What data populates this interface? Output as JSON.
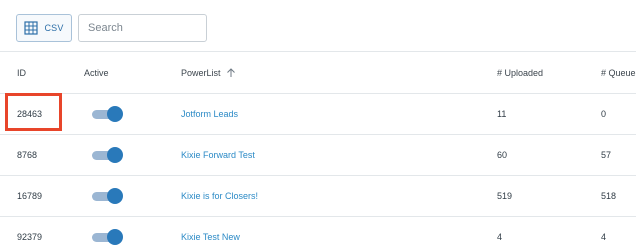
{
  "toolbar": {
    "csv_label": "CSV",
    "csv_icon": "grid-icon",
    "search_placeholder": "Search",
    "search_value": ""
  },
  "table": {
    "columns": {
      "id": "ID",
      "active": "Active",
      "powerlist": "PowerList",
      "uploaded": "# Uploaded",
      "queued": "# Queue"
    },
    "sort": {
      "column": "powerlist",
      "direction": "ascending",
      "icon": "arrow-up-icon"
    },
    "rows": [
      {
        "id": "28463",
        "active": true,
        "powerlist": "Jotform Leads",
        "uploaded": "11",
        "queued": "0"
      },
      {
        "id": "8768",
        "active": true,
        "powerlist": "Kixie Forward Test",
        "uploaded": "60",
        "queued": "57"
      },
      {
        "id": "16789",
        "active": true,
        "powerlist": "Kixie is for Closers!",
        "uploaded": "519",
        "queued": "518"
      },
      {
        "id": "92379",
        "active": true,
        "powerlist": "Kixie Test New",
        "uploaded": "4",
        "queued": "4"
      }
    ]
  },
  "colors": {
    "link": "#2b8ac6",
    "toggle_on_knob": "#2979ba",
    "toggle_on_track": "#9bb6d3",
    "highlight": "#e8452a"
  }
}
